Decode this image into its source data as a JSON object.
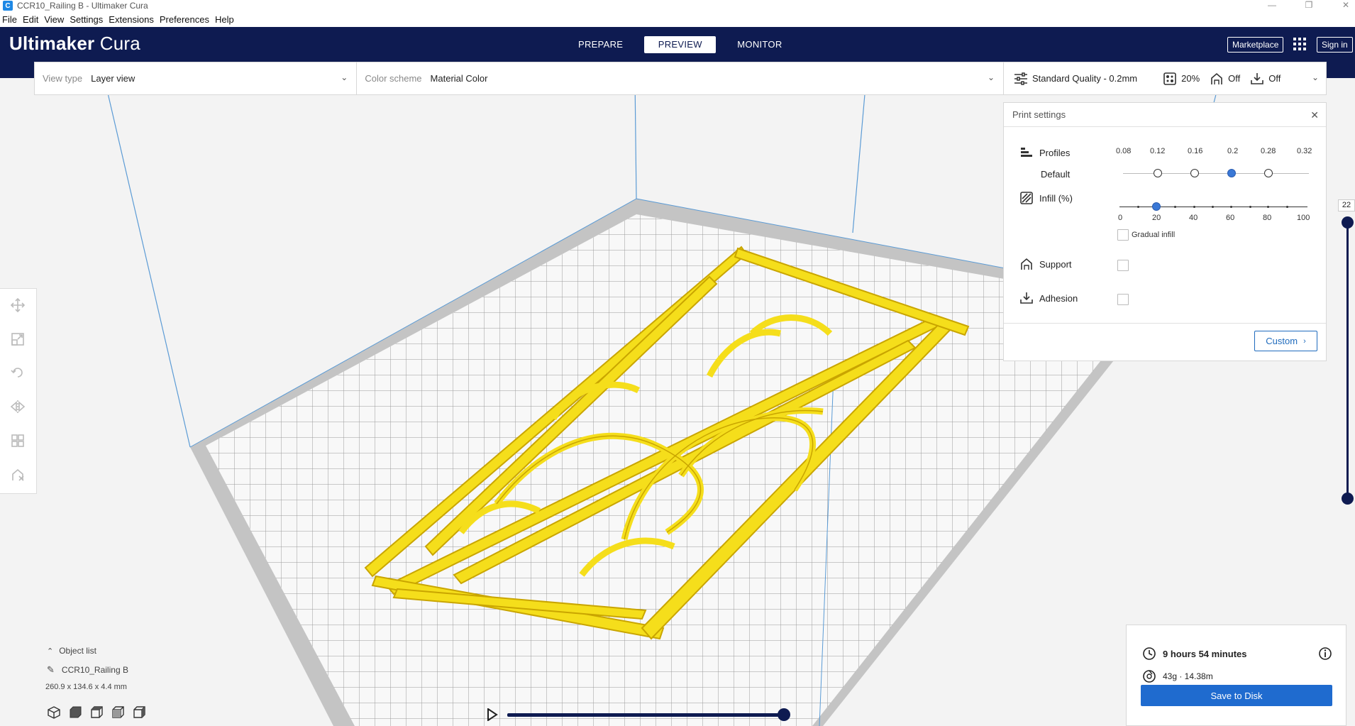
{
  "window": {
    "title": "CCR10_Railing B - Ultimaker Cura",
    "app_icon_letter": "C"
  },
  "menu": {
    "items": [
      "File",
      "Edit",
      "View",
      "Settings",
      "Extensions",
      "Preferences",
      "Help"
    ]
  },
  "header": {
    "brand_bold": "Ultimaker",
    "brand_light": " Cura",
    "tabs": [
      {
        "label": "PREPARE",
        "active": false
      },
      {
        "label": "PREVIEW",
        "active": true
      },
      {
        "label": "MONITOR",
        "active": false
      }
    ],
    "marketplace_label": "Marketplace",
    "signin_label": "Sign in"
  },
  "view_bar": {
    "view_type_label": "View type",
    "view_type_value": "Layer view",
    "color_scheme_label": "Color scheme",
    "color_scheme_value": "Material Color"
  },
  "settings_bar": {
    "profile": "Standard Quality - 0.2mm",
    "infill": "20%",
    "support": "Off",
    "adhesion": "Off"
  },
  "print_settings": {
    "title": "Print settings",
    "profiles_label": "Profiles",
    "default_label": "Default",
    "profile_ticks": [
      "0.08",
      "0.12",
      "0.16",
      "0.2",
      "0.28",
      "0.32"
    ],
    "selected_profile": "0.2",
    "infill_label": "Infill (%)",
    "infill_ticks": [
      "0",
      "20",
      "40",
      "60",
      "80",
      "100"
    ],
    "infill_value": 20,
    "gradual_infill_label": "Gradual infill",
    "gradual_infill_checked": false,
    "support_label": "Support",
    "support_checked": false,
    "adhesion_label": "Adhesion",
    "adhesion_checked": false,
    "custom_button_label": "Custom"
  },
  "layer_slider": {
    "current_layer": "22"
  },
  "object_list": {
    "toggle_label": "Object list",
    "object_name": "CCR10_Railing B",
    "dimensions": "260.9 x 134.6 x 4.4 mm"
  },
  "estimate": {
    "time": "9 hours 54 minutes",
    "material": "43g · 14.38m",
    "save_label": "Save to Disk"
  },
  "colors": {
    "header_bg": "#0e1b51",
    "accent": "#1f6bcf",
    "model": "#f5de1b",
    "build_plate": "#f7f7f7"
  }
}
